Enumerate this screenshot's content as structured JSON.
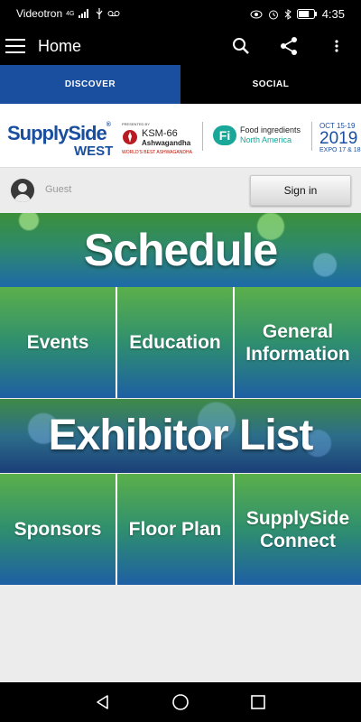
{
  "status_bar": {
    "carrier": "Videotron",
    "net_type": "4G",
    "battery_level": 0.7,
    "time": "4:35"
  },
  "app_bar": {
    "title": "Home"
  },
  "tabs": [
    {
      "label": "DISCOVER",
      "active": true
    },
    {
      "label": "SOCIAL",
      "active": false
    }
  ],
  "banner": {
    "brand_line1": "SupplySide",
    "brand_reg": "®",
    "brand_line2": "WEST",
    "ksm_presented": "PRESENTED BY",
    "ksm_name": "KSM-66",
    "ksm_sub": "Ashwagandha",
    "ksm_tagline": "WORLD'S BEST ASHWAGANDHA",
    "fi_logo": "Fi",
    "fi_line1": "Food ingredients",
    "fi_line2": "North America",
    "dates_line1": "OCT 15-19",
    "dates_year": "2019",
    "dates_line3": "EXPO 17 & 18"
  },
  "user": {
    "name": "Guest",
    "sign_in_label": "Sign in"
  },
  "schedule": {
    "title": "Schedule",
    "tiles": [
      {
        "label": "Events"
      },
      {
        "label": "Education"
      },
      {
        "label": "General Information"
      }
    ]
  },
  "exhibitor": {
    "title": "Exhibitor List",
    "tiles": [
      {
        "label": "Sponsors"
      },
      {
        "label": "Floor Plan"
      },
      {
        "label": "SupplySide Connect"
      }
    ]
  },
  "colors": {
    "accent": "#1a4fa0",
    "tile_top": "#5bb04a",
    "tile_bottom": "#1e5fa4"
  }
}
